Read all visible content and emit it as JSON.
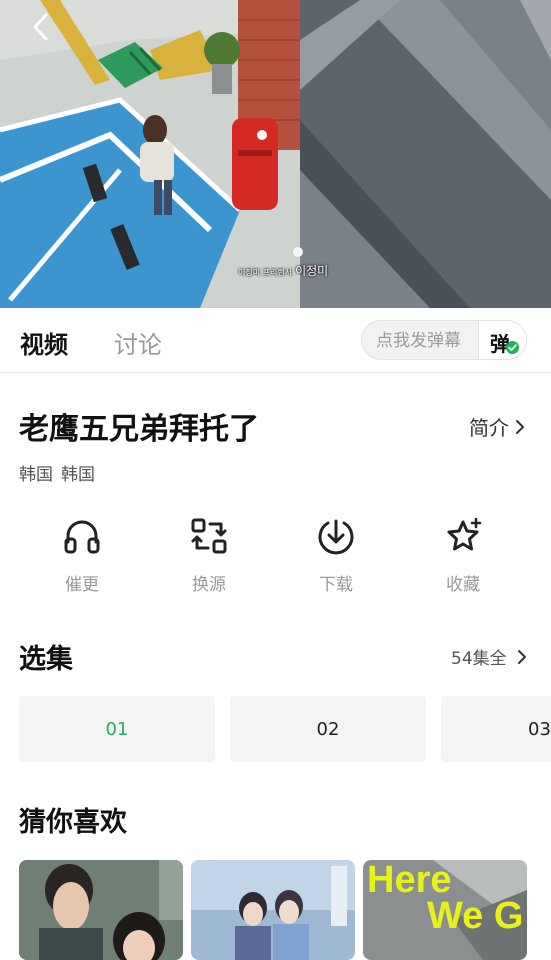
{
  "player": {
    "back_icon": "chevron-left-icon",
    "subtitle_small": "이정미 프리랜서",
    "subtitle_name": "이정미"
  },
  "tabs": [
    {
      "label": "视频",
      "active": true
    },
    {
      "label": "讨论",
      "active": false
    }
  ],
  "danmu": {
    "placeholder": "点我发弹幕",
    "toggle_char": "弹",
    "toggle_on": true,
    "toggle_color": "#1fb35a"
  },
  "show": {
    "title": "老鹰五兄弟拜托了",
    "intro_label": "简介",
    "tags": [
      "韩国",
      "韩国"
    ]
  },
  "actions": [
    {
      "label": "催更",
      "icon": "headphones-icon"
    },
    {
      "label": "换源",
      "icon": "switch-source-icon"
    },
    {
      "label": "下载",
      "icon": "download-icon"
    },
    {
      "label": "收藏",
      "icon": "star-icon"
    }
  ],
  "episodes": {
    "section_title": "选集",
    "all_label": "54集全",
    "items": [
      "01",
      "02",
      "03"
    ],
    "active_index": 0,
    "active_color": "#1fb35a"
  },
  "recommend": {
    "section_title": "猜你喜欢",
    "posters": [
      {
        "title_text": ""
      },
      {
        "title_text": ""
      },
      {
        "title_text": "Here We G"
      }
    ]
  }
}
